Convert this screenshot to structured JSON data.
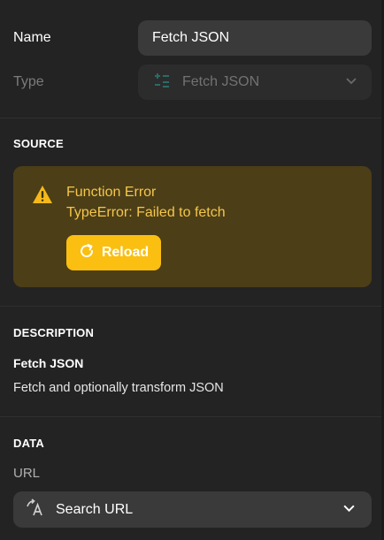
{
  "fields": {
    "name_label": "Name",
    "name_value": "Fetch JSON",
    "type_label": "Type",
    "type_value": "Fetch JSON",
    "type_icon": "function-icon"
  },
  "source": {
    "title": "SOURCE",
    "error_title": "Function Error",
    "error_message": "TypeError: Failed to fetch",
    "reload_label": "Reload",
    "warning_icon": "warning-icon"
  },
  "description": {
    "title": "DESCRIPTION",
    "name": "Fetch JSON",
    "text": "Fetch and optionally transform JSON"
  },
  "data": {
    "title": "DATA",
    "url_label": "URL",
    "url_select_value": "Search URL",
    "url_icon": "search-url-icon"
  },
  "colors": {
    "background": "#232323",
    "warning_bg": "#4c3e17",
    "warning_text": "#f4c64a",
    "reload_button": "#fbbf11",
    "input_bg": "#3a3a3a"
  }
}
